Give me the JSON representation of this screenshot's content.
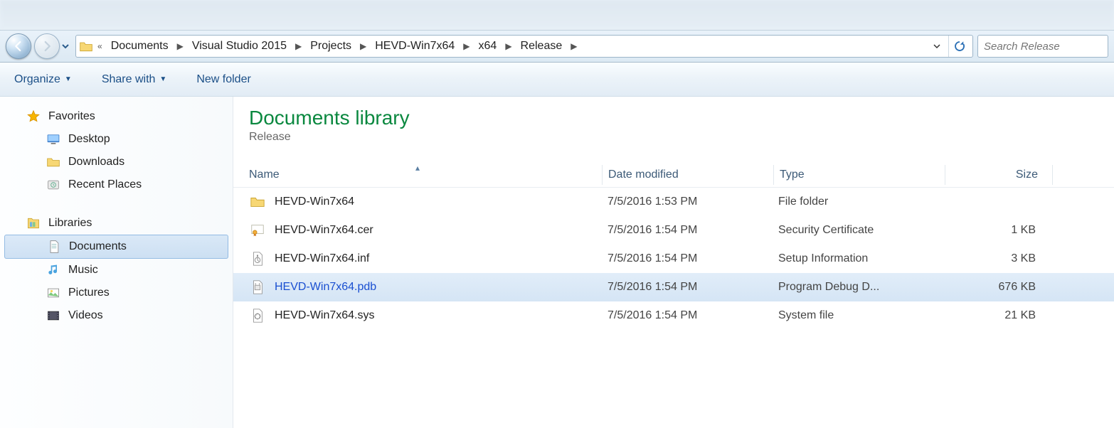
{
  "breadcrumbs": [
    "Documents",
    "Visual Studio 2015",
    "Projects",
    "HEVD-Win7x64",
    "x64",
    "Release"
  ],
  "search": {
    "placeholder": "Search Release"
  },
  "toolbar": {
    "organize": "Organize",
    "share": "Share with",
    "newfolder": "New folder"
  },
  "nav": {
    "favorites": {
      "label": "Favorites",
      "items": [
        "Desktop",
        "Downloads",
        "Recent Places"
      ]
    },
    "libraries": {
      "label": "Libraries",
      "items": [
        "Documents",
        "Music",
        "Pictures",
        "Videos"
      ]
    }
  },
  "library": {
    "title": "Documents library",
    "sub": "Release"
  },
  "columns": {
    "name": "Name",
    "date": "Date modified",
    "type": "Type",
    "size": "Size"
  },
  "files": [
    {
      "name": "HEVD-Win7x64",
      "date": "7/5/2016 1:53 PM",
      "type": "File folder",
      "size": "",
      "icon": "folder"
    },
    {
      "name": "HEVD-Win7x64.cer",
      "date": "7/5/2016 1:54 PM",
      "type": "Security Certificate",
      "size": "1 KB",
      "icon": "cert"
    },
    {
      "name": "HEVD-Win7x64.inf",
      "date": "7/5/2016 1:54 PM",
      "type": "Setup Information",
      "size": "3 KB",
      "icon": "inf"
    },
    {
      "name": "HEVD-Win7x64.pdb",
      "date": "7/5/2016 1:54 PM",
      "type": "Program Debug D...",
      "size": "676 KB",
      "icon": "pdb",
      "selected": true
    },
    {
      "name": "HEVD-Win7x64.sys",
      "date": "7/5/2016 1:54 PM",
      "type": "System file",
      "size": "21 KB",
      "icon": "sys"
    }
  ]
}
